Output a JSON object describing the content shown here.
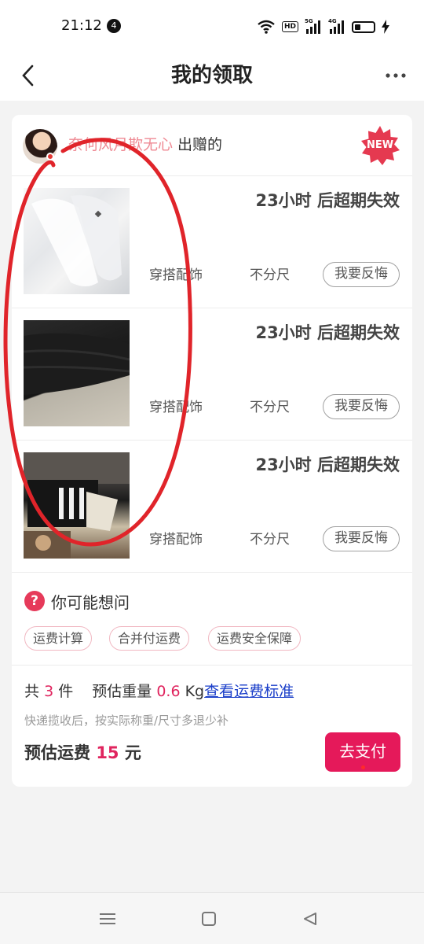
{
  "status_bar": {
    "time": "21:12",
    "notification_count": "4",
    "hd_label": "HD",
    "signal1_label": "5G",
    "signal2_label": "4G"
  },
  "nav": {
    "title": "我的领取",
    "back_icon": "chevron-left-icon",
    "more_icon": "more-horizontal-icon"
  },
  "giver": {
    "name": "奈何风月欺无心",
    "suffix": "出赠的",
    "badge": "NEW"
  },
  "items": [
    {
      "expire": "23小时 后超期失效",
      "category": "穿搭配饰",
      "size": "不分尺",
      "action": "我要反悔"
    },
    {
      "expire": "23小时 后超期失效",
      "category": "穿搭配饰",
      "size": "不分尺",
      "action": "我要反悔"
    },
    {
      "expire": "23小时 后超期失效",
      "category": "穿搭配饰",
      "size": "不分尺",
      "action": "我要反悔"
    }
  ],
  "faq": {
    "icon": "question-circle-icon",
    "title": "你可能想问",
    "chips": [
      "运费计算",
      "合并付运费",
      "运费安全保障"
    ]
  },
  "summary": {
    "count_prefix": "共",
    "count": "3",
    "count_unit": "件",
    "weight_label": "预估重量",
    "weight_value": "0.6",
    "weight_unit": "Kg",
    "shipping_link": "查看运费标准",
    "note": "快递揽收后，按实际称重/尺寸多退少补",
    "fee_label": "预估运费",
    "fee_value": "15",
    "fee_unit": "元",
    "pay_button": "去支付"
  },
  "colors": {
    "accent": "#e5195a",
    "giver_name": "#ef8a94",
    "link": "#1a3ec9",
    "new_badge": "#e53950",
    "annotation_stroke": "#e0242a"
  },
  "bottom_nav": {
    "icons": [
      "menu-icon",
      "home-square-icon",
      "back-triangle-icon"
    ]
  }
}
